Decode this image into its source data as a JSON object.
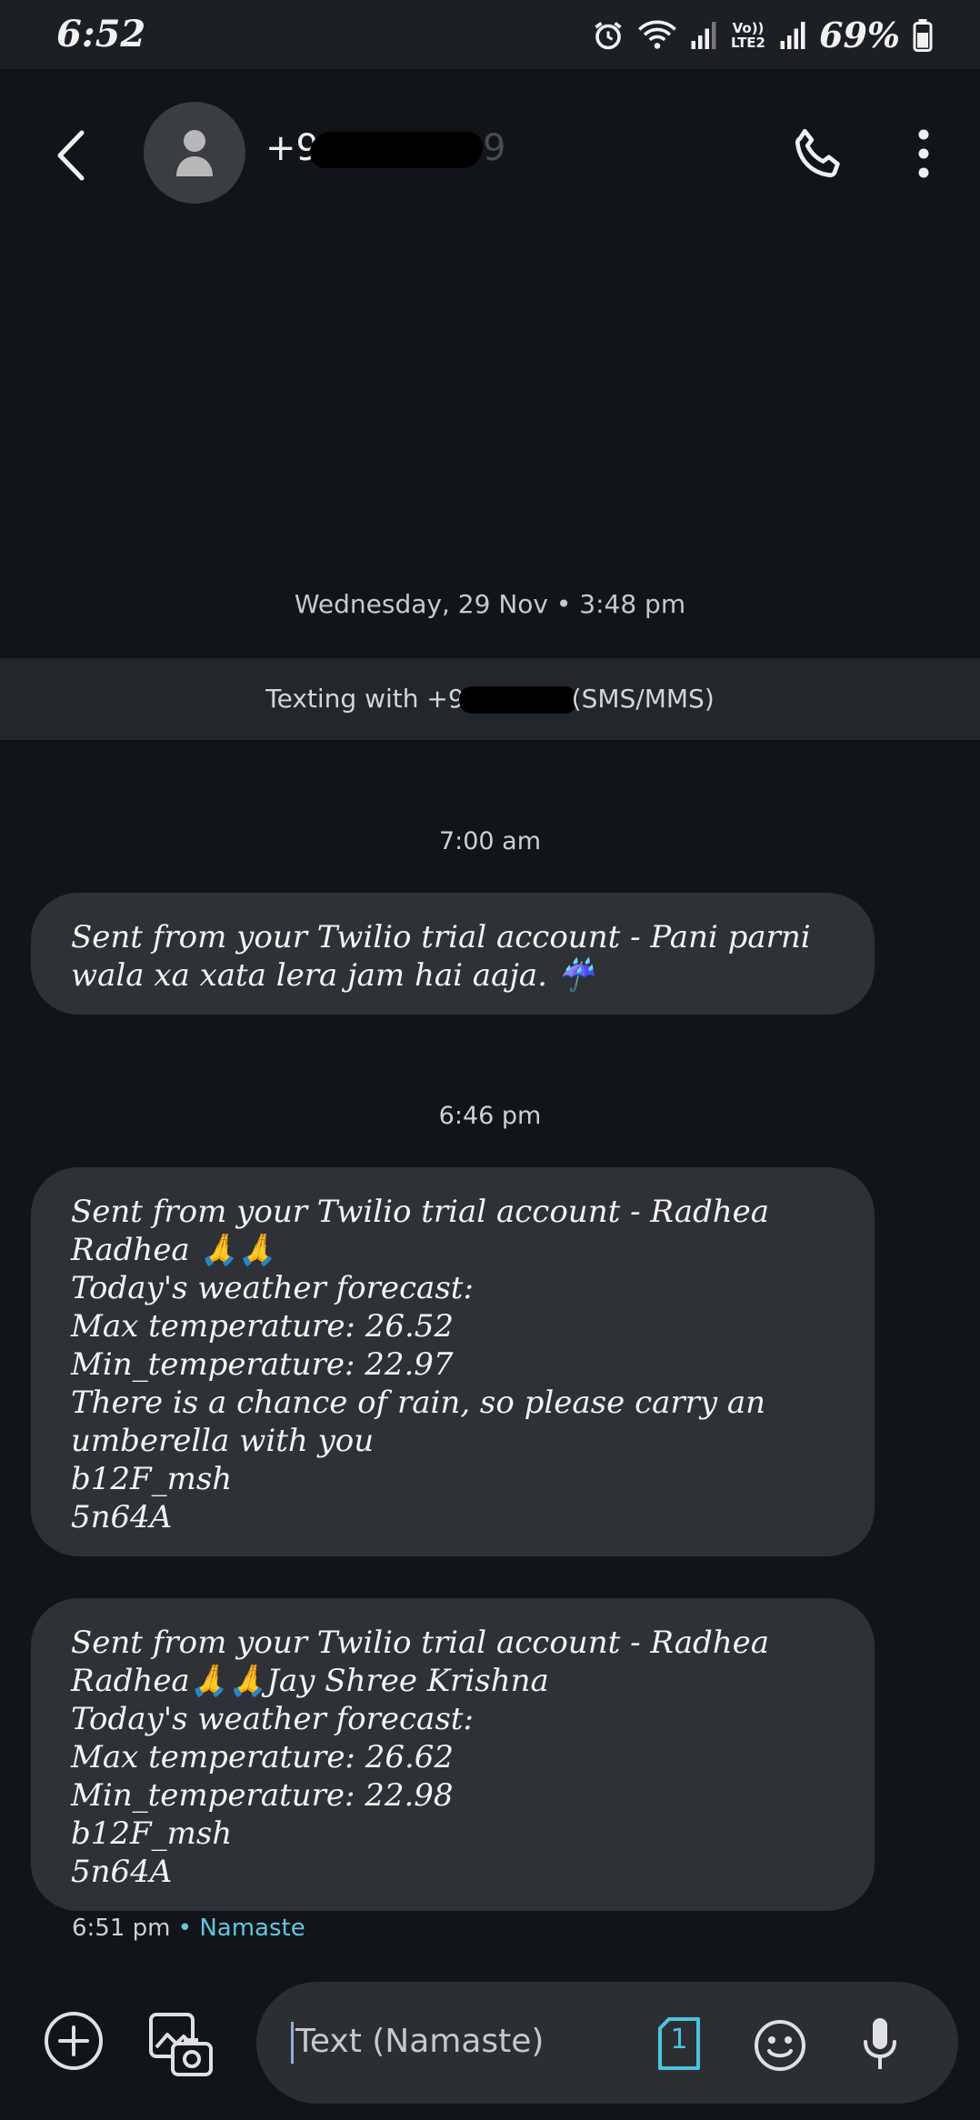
{
  "status_bar": {
    "time": "6:52",
    "network_label": "Vo)) LTE2",
    "battery": "69%"
  },
  "header": {
    "contact_prefix": "+9",
    "contact_suffix": "9"
  },
  "conversation": {
    "date_header": "Wednesday, 29 Nov • 3:48 pm",
    "texting_with_prefix": "Texting with +9",
    "texting_with_suffix": "(SMS/MMS)",
    "groups": [
      {
        "time": "7:00 am",
        "messages": [
          "Sent from your Twilio trial account - Pani parni wala xa xata lera jam hai aaja. ☔"
        ]
      },
      {
        "time": "6:46 pm",
        "messages": [
          "Sent from your Twilio trial account - Radhea Radhea 🙏🙏\nToday's weather forecast:\nMax temperature: 26.52\nMin_temperature: 22.97\nThere is a chance of rain, so please carry an umberella with you\nb12F_msh\n5n64A",
          "Sent from your Twilio trial account - Radhea Radhea🙏🙏Jay Shree Krishna\nToday's weather forecast:\nMax temperature: 26.62\nMin_temperature: 22.98\nb12F_msh\n5n64A"
        ]
      }
    ],
    "last_meta_time": "6:51 pm",
    "last_meta_sim": "• Namaste"
  },
  "composer": {
    "placeholder": "Text (Namaste)",
    "sim_number": "1"
  },
  "colors": {
    "background": "#111418",
    "bubble": "#2e3136",
    "accent": "#5ec8e0"
  }
}
